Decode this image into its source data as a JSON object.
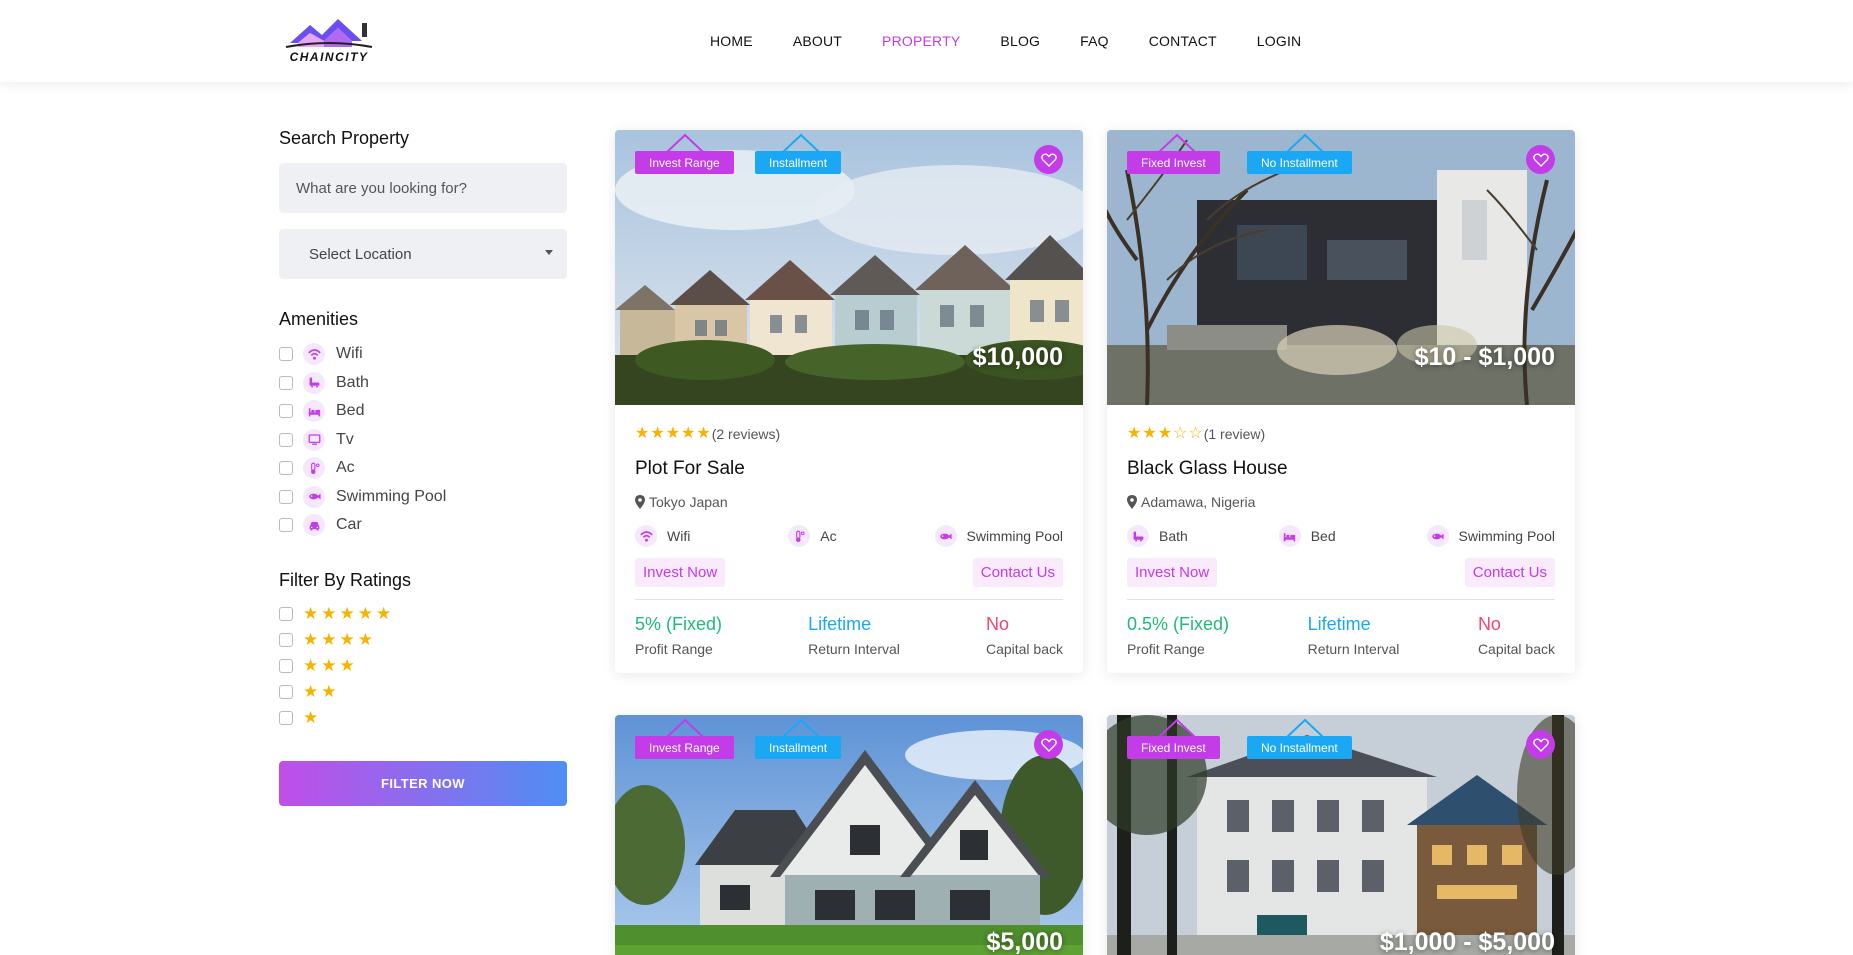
{
  "header": {
    "logo_text": "CHAINCITY",
    "nav": [
      {
        "label": "HOME",
        "active": false
      },
      {
        "label": "ABOUT",
        "active": false
      },
      {
        "label": "PROPERTY",
        "active": true
      },
      {
        "label": "BLOG",
        "active": false
      },
      {
        "label": "FAQ",
        "active": false
      },
      {
        "label": "CONTACT",
        "active": false
      },
      {
        "label": "LOGIN",
        "active": false
      }
    ]
  },
  "sidebar": {
    "search_title": "Search Property",
    "search_placeholder": "What are you looking for?",
    "location_select": "Select Location",
    "amenities_title": "Amenities",
    "amenities": [
      {
        "label": "Wifi",
        "icon": "wifi-icon"
      },
      {
        "label": "Bath",
        "icon": "bath-icon"
      },
      {
        "label": "Bed",
        "icon": "bed-icon"
      },
      {
        "label": "Tv",
        "icon": "tv-icon"
      },
      {
        "label": "Ac",
        "icon": "thermometer-icon"
      },
      {
        "label": "Swimming Pool",
        "icon": "fish-icon"
      },
      {
        "label": "Car",
        "icon": "car-icon"
      }
    ],
    "ratings_title": "Filter By Ratings",
    "ratings": [
      5,
      4,
      3,
      2,
      1
    ],
    "filter_button": "FILTER NOW"
  },
  "cards": [
    {
      "tag1": "Invest Range",
      "tag2": "Installment",
      "price": "$10,000",
      "rating": 5,
      "reviews": "(2 reviews)",
      "title": "Plot For Sale",
      "location": "Tokyo Japan",
      "amenities": [
        "Wifi",
        "Ac",
        "Swimming Pool"
      ],
      "invest_button": "Invest Now",
      "contact_button": "Contact Us",
      "profit_value": "5% (Fixed)",
      "profit_label": "Profit Range",
      "return_value": "Lifetime",
      "return_label": "Return Interval",
      "capital_value": "No",
      "capital_label": "Capital back"
    },
    {
      "tag1": "Fixed Invest",
      "tag2": "No Installment",
      "price": "$10 - $1,000",
      "rating": 3,
      "reviews": "(1 review)",
      "title": "Black Glass House",
      "location": "Adamawa, Nigeria",
      "amenities": [
        "Bath",
        "Bed",
        "Swimming Pool"
      ],
      "invest_button": "Invest Now",
      "contact_button": "Contact Us",
      "profit_value": "0.5% (Fixed)",
      "profit_label": "Profit Range",
      "return_value": "Lifetime",
      "return_label": "Return Interval",
      "capital_value": "No",
      "capital_label": "Capital back"
    },
    {
      "tag1": "Invest Range",
      "tag2": "Installment",
      "price": "$5,000"
    },
    {
      "tag1": "Fixed Invest",
      "tag2": "No Installment",
      "price": "$1,000 - $5,000"
    }
  ],
  "colors": {
    "accent": "#c33ce8",
    "blue": "#1aa8f5",
    "green": "#1dbb7a",
    "red": "#f0466e",
    "star": "#f6b400"
  }
}
